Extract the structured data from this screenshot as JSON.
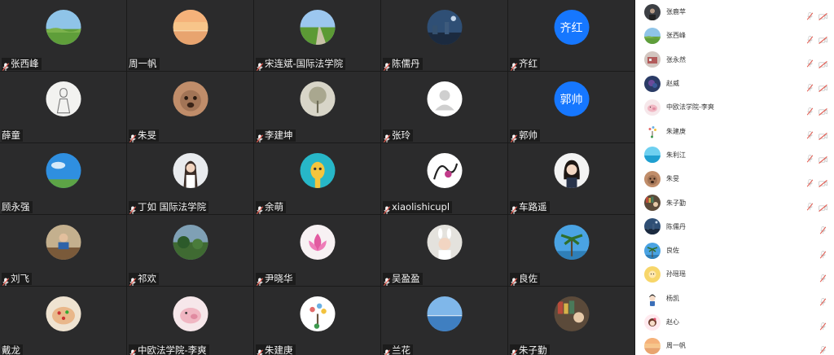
{
  "colors": {
    "grid_bg": "#1a1a1a",
    "tile_bg": "#2b2b2c",
    "text_avatar_blue": "#1677ff",
    "muted_red": "#e2574c",
    "panel_bg": "#ffffff"
  },
  "tiles": [
    {
      "name": "张西峰",
      "avatar": "meadow-photo",
      "muted": true
    },
    {
      "name": "周一帆",
      "avatar": "sunset-sea-photo",
      "muted": false
    },
    {
      "name": "宋连斌-国际法学院",
      "avatar": "road-field-photo",
      "muted": true
    },
    {
      "name": "陈儒丹",
      "avatar": "night-city-photo",
      "muted": true
    },
    {
      "name": "齐红",
      "avatar_text": "齐红",
      "avatar": "text-avatar",
      "muted": true
    },
    {
      "name": "薛童",
      "avatar": "sketch-figure",
      "muted": false
    },
    {
      "name": "朱旻",
      "avatar": "pug-dog-photo",
      "muted": true
    },
    {
      "name": "李建坤",
      "avatar": "tree-photo",
      "muted": true
    },
    {
      "name": "张玲",
      "avatar": "default-person",
      "muted": true
    },
    {
      "name": "郭帅",
      "avatar_text": "郭帅",
      "avatar": "text-avatar",
      "muted": true
    },
    {
      "name": "顾永强",
      "avatar": "blue-sky-photo",
      "muted": false
    },
    {
      "name": "丁如 国际法学院",
      "avatar": "woman-portrait",
      "muted": true
    },
    {
      "name": "余萌",
      "avatar": "giraffe-cartoon",
      "muted": true
    },
    {
      "name": "xiaolishicupl",
      "avatar": "ink-art",
      "muted": true
    },
    {
      "name": "车路遥",
      "avatar": "girl-portrait",
      "muted": true
    },
    {
      "name": "刘飞",
      "avatar": "man-desk-photo",
      "muted": true
    },
    {
      "name": "祁欢",
      "avatar": "garden-photo",
      "muted": true
    },
    {
      "name": "尹晓华",
      "avatar": "lotus-flower",
      "muted": true
    },
    {
      "name": "吴盈盈",
      "avatar": "bunny-kid-photo",
      "muted": true
    },
    {
      "name": "良佐",
      "avatar": "palm-tree-photo",
      "muted": true
    },
    {
      "name": "戴龙",
      "avatar": "cake-photo",
      "muted": false
    },
    {
      "name": "中欧法学院-李爽",
      "avatar": "pink-pig-photo",
      "muted": true
    },
    {
      "name": "朱建庚",
      "avatar": "tree-drawing",
      "muted": true
    },
    {
      "name": "兰花",
      "avatar": "lake-photo",
      "muted": true
    },
    {
      "name": "朱子勤",
      "avatar": "bookshelf-photo",
      "muted": true
    }
  ],
  "participants": [
    {
      "name": "张鹿苹",
      "avatar": "dark-portrait",
      "cam": true
    },
    {
      "name": "张西峰",
      "avatar": "meadow-photo",
      "cam": true
    },
    {
      "name": "张永然",
      "avatar": "room-photo",
      "cam": true
    },
    {
      "name": "赵威",
      "avatar": "dark-blue-photo",
      "cam": true
    },
    {
      "name": "中欧法学院-李爽",
      "avatar": "pink-pig-photo",
      "cam": true
    },
    {
      "name": "朱建庚",
      "avatar": "tree-drawing",
      "cam": true
    },
    {
      "name": "朱利江",
      "avatar": "sea-photo",
      "cam": true
    },
    {
      "name": "朱旻",
      "avatar": "pug-dog-photo",
      "cam": true
    },
    {
      "name": "朱子勤",
      "avatar": "bookshelf-photo",
      "cam": true
    },
    {
      "name": "陈儒丹",
      "avatar": "night-city-photo",
      "cam": false
    },
    {
      "name": "良佐",
      "avatar": "palm-tree-photo",
      "cam": false
    },
    {
      "name": "孙瑶瑶",
      "avatar": "yellow-cartoon",
      "cam": false
    },
    {
      "name": "杨凯",
      "avatar": "boy-cartoon",
      "cam": false
    },
    {
      "name": "赵心",
      "avatar": "girl-cartoon",
      "cam": false
    },
    {
      "name": "周一帆",
      "avatar": "sunset-sea-photo",
      "cam": false
    }
  ]
}
